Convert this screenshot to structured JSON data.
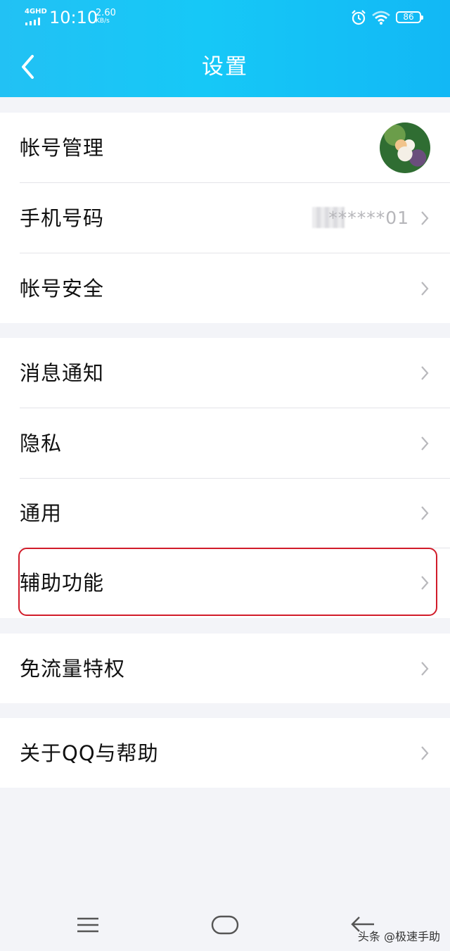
{
  "status_bar": {
    "network": "4GHD",
    "time": "10:10",
    "speed_value": "2.60",
    "speed_unit": "KB/s",
    "battery": "86"
  },
  "header": {
    "title": "设置",
    "back_icon": "chevron-left-icon"
  },
  "groups": [
    {
      "items": [
        {
          "label": "帐号管理",
          "trailing": "avatar"
        },
        {
          "label": "手机号码",
          "value": "******01"
        },
        {
          "label": "帐号安全"
        }
      ]
    },
    {
      "items": [
        {
          "label": "消息通知"
        },
        {
          "label": "隐私"
        },
        {
          "label": "通用"
        },
        {
          "label": "辅助功能",
          "highlighted": true
        }
      ]
    },
    {
      "items": [
        {
          "label": "免流量特权"
        }
      ]
    },
    {
      "items": [
        {
          "label": "关于QQ与帮助"
        }
      ]
    }
  ],
  "nav": {
    "menu_icon": "menu-icon",
    "home_icon": "home-icon",
    "back_icon": "back-arrow-icon"
  },
  "watermark": "头条 @极速手助",
  "colors": {
    "header": "#18c4f6",
    "highlight_border": "#d11c2a",
    "background": "#f3f4f8"
  }
}
